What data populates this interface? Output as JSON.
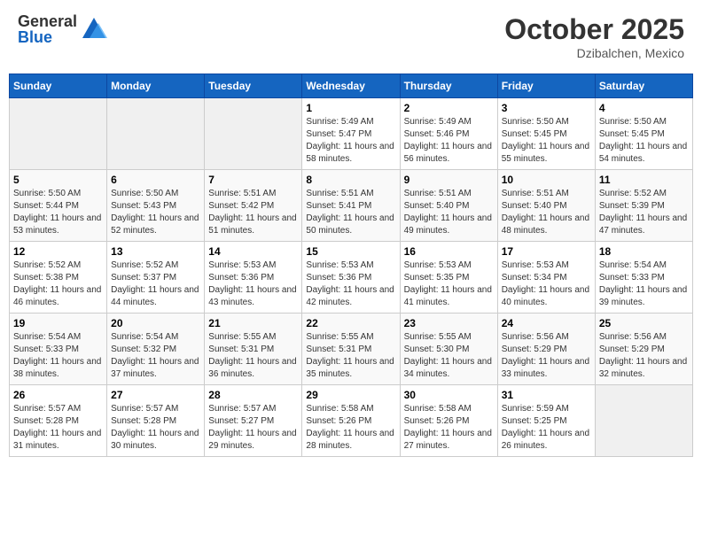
{
  "header": {
    "logo_general": "General",
    "logo_blue": "Blue",
    "month_title": "October 2025",
    "location": "Dzibalchen, Mexico"
  },
  "weekdays": [
    "Sunday",
    "Monday",
    "Tuesday",
    "Wednesday",
    "Thursday",
    "Friday",
    "Saturday"
  ],
  "weeks": [
    [
      {
        "day": "",
        "sunrise": "",
        "sunset": "",
        "daylight": ""
      },
      {
        "day": "",
        "sunrise": "",
        "sunset": "",
        "daylight": ""
      },
      {
        "day": "",
        "sunrise": "",
        "sunset": "",
        "daylight": ""
      },
      {
        "day": "1",
        "sunrise": "Sunrise: 5:49 AM",
        "sunset": "Sunset: 5:47 PM",
        "daylight": "Daylight: 11 hours and 58 minutes."
      },
      {
        "day": "2",
        "sunrise": "Sunrise: 5:49 AM",
        "sunset": "Sunset: 5:46 PM",
        "daylight": "Daylight: 11 hours and 56 minutes."
      },
      {
        "day": "3",
        "sunrise": "Sunrise: 5:50 AM",
        "sunset": "Sunset: 5:45 PM",
        "daylight": "Daylight: 11 hours and 55 minutes."
      },
      {
        "day": "4",
        "sunrise": "Sunrise: 5:50 AM",
        "sunset": "Sunset: 5:45 PM",
        "daylight": "Daylight: 11 hours and 54 minutes."
      }
    ],
    [
      {
        "day": "5",
        "sunrise": "Sunrise: 5:50 AM",
        "sunset": "Sunset: 5:44 PM",
        "daylight": "Daylight: 11 hours and 53 minutes."
      },
      {
        "day": "6",
        "sunrise": "Sunrise: 5:50 AM",
        "sunset": "Sunset: 5:43 PM",
        "daylight": "Daylight: 11 hours and 52 minutes."
      },
      {
        "day": "7",
        "sunrise": "Sunrise: 5:51 AM",
        "sunset": "Sunset: 5:42 PM",
        "daylight": "Daylight: 11 hours and 51 minutes."
      },
      {
        "day": "8",
        "sunrise": "Sunrise: 5:51 AM",
        "sunset": "Sunset: 5:41 PM",
        "daylight": "Daylight: 11 hours and 50 minutes."
      },
      {
        "day": "9",
        "sunrise": "Sunrise: 5:51 AM",
        "sunset": "Sunset: 5:40 PM",
        "daylight": "Daylight: 11 hours and 49 minutes."
      },
      {
        "day": "10",
        "sunrise": "Sunrise: 5:51 AM",
        "sunset": "Sunset: 5:40 PM",
        "daylight": "Daylight: 11 hours and 48 minutes."
      },
      {
        "day": "11",
        "sunrise": "Sunrise: 5:52 AM",
        "sunset": "Sunset: 5:39 PM",
        "daylight": "Daylight: 11 hours and 47 minutes."
      }
    ],
    [
      {
        "day": "12",
        "sunrise": "Sunrise: 5:52 AM",
        "sunset": "Sunset: 5:38 PM",
        "daylight": "Daylight: 11 hours and 46 minutes."
      },
      {
        "day": "13",
        "sunrise": "Sunrise: 5:52 AM",
        "sunset": "Sunset: 5:37 PM",
        "daylight": "Daylight: 11 hours and 44 minutes."
      },
      {
        "day": "14",
        "sunrise": "Sunrise: 5:53 AM",
        "sunset": "Sunset: 5:36 PM",
        "daylight": "Daylight: 11 hours and 43 minutes."
      },
      {
        "day": "15",
        "sunrise": "Sunrise: 5:53 AM",
        "sunset": "Sunset: 5:36 PM",
        "daylight": "Daylight: 11 hours and 42 minutes."
      },
      {
        "day": "16",
        "sunrise": "Sunrise: 5:53 AM",
        "sunset": "Sunset: 5:35 PM",
        "daylight": "Daylight: 11 hours and 41 minutes."
      },
      {
        "day": "17",
        "sunrise": "Sunrise: 5:53 AM",
        "sunset": "Sunset: 5:34 PM",
        "daylight": "Daylight: 11 hours and 40 minutes."
      },
      {
        "day": "18",
        "sunrise": "Sunrise: 5:54 AM",
        "sunset": "Sunset: 5:33 PM",
        "daylight": "Daylight: 11 hours and 39 minutes."
      }
    ],
    [
      {
        "day": "19",
        "sunrise": "Sunrise: 5:54 AM",
        "sunset": "Sunset: 5:33 PM",
        "daylight": "Daylight: 11 hours and 38 minutes."
      },
      {
        "day": "20",
        "sunrise": "Sunrise: 5:54 AM",
        "sunset": "Sunset: 5:32 PM",
        "daylight": "Daylight: 11 hours and 37 minutes."
      },
      {
        "day": "21",
        "sunrise": "Sunrise: 5:55 AM",
        "sunset": "Sunset: 5:31 PM",
        "daylight": "Daylight: 11 hours and 36 minutes."
      },
      {
        "day": "22",
        "sunrise": "Sunrise: 5:55 AM",
        "sunset": "Sunset: 5:31 PM",
        "daylight": "Daylight: 11 hours and 35 minutes."
      },
      {
        "day": "23",
        "sunrise": "Sunrise: 5:55 AM",
        "sunset": "Sunset: 5:30 PM",
        "daylight": "Daylight: 11 hours and 34 minutes."
      },
      {
        "day": "24",
        "sunrise": "Sunrise: 5:56 AM",
        "sunset": "Sunset: 5:29 PM",
        "daylight": "Daylight: 11 hours and 33 minutes."
      },
      {
        "day": "25",
        "sunrise": "Sunrise: 5:56 AM",
        "sunset": "Sunset: 5:29 PM",
        "daylight": "Daylight: 11 hours and 32 minutes."
      }
    ],
    [
      {
        "day": "26",
        "sunrise": "Sunrise: 5:57 AM",
        "sunset": "Sunset: 5:28 PM",
        "daylight": "Daylight: 11 hours and 31 minutes."
      },
      {
        "day": "27",
        "sunrise": "Sunrise: 5:57 AM",
        "sunset": "Sunset: 5:28 PM",
        "daylight": "Daylight: 11 hours and 30 minutes."
      },
      {
        "day": "28",
        "sunrise": "Sunrise: 5:57 AM",
        "sunset": "Sunset: 5:27 PM",
        "daylight": "Daylight: 11 hours and 29 minutes."
      },
      {
        "day": "29",
        "sunrise": "Sunrise: 5:58 AM",
        "sunset": "Sunset: 5:26 PM",
        "daylight": "Daylight: 11 hours and 28 minutes."
      },
      {
        "day": "30",
        "sunrise": "Sunrise: 5:58 AM",
        "sunset": "Sunset: 5:26 PM",
        "daylight": "Daylight: 11 hours and 27 minutes."
      },
      {
        "day": "31",
        "sunrise": "Sunrise: 5:59 AM",
        "sunset": "Sunset: 5:25 PM",
        "daylight": "Daylight: 11 hours and 26 minutes."
      },
      {
        "day": "",
        "sunrise": "",
        "sunset": "",
        "daylight": ""
      }
    ]
  ]
}
